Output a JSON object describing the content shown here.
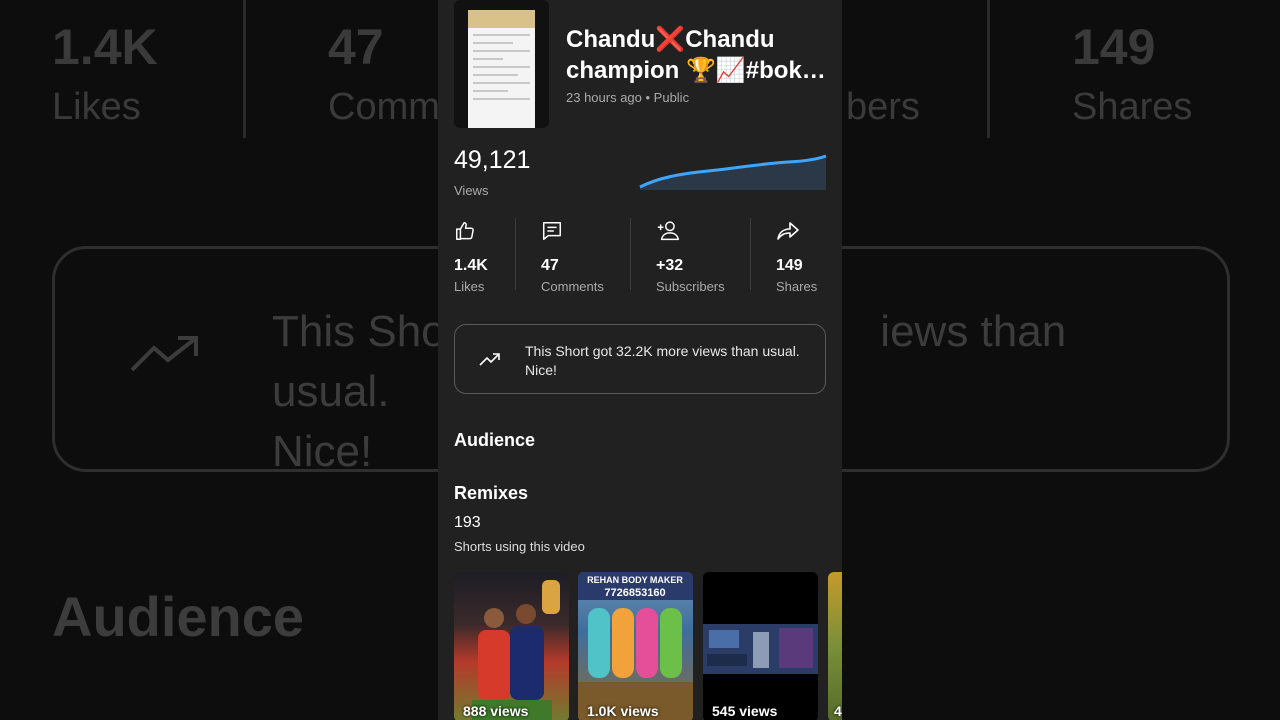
{
  "background": {
    "stats": [
      {
        "value": "1.4K",
        "label": "Likes"
      },
      {
        "value": "47",
        "label": "Comm"
      },
      {
        "value": "",
        "label": "bers"
      },
      {
        "value": "149",
        "label": "Shares"
      }
    ],
    "insight_left": "This Shor",
    "insight_right": "iews than usual.",
    "insight_line2": "Nice!",
    "audience": "Audience"
  },
  "video": {
    "title": "Chandu❌Chandu champion 🏆📈#bok…",
    "meta": "23 hours ago • Public",
    "views_value": "49,121",
    "views_label": "Views"
  },
  "stats": [
    {
      "icon": "thumbs-up-icon",
      "value": "1.4K",
      "label": "Likes"
    },
    {
      "icon": "comment-icon",
      "value": "47",
      "label": "Comments"
    },
    {
      "icon": "add-subscriber-icon",
      "value": "+32",
      "label": "Subscribers"
    },
    {
      "icon": "share-icon",
      "value": "149",
      "label": "Shares"
    }
  ],
  "insight": {
    "icon": "trending-up-icon",
    "text": "This Short got 32.2K more views than usual. Nice!"
  },
  "audience": {
    "heading": "Audience"
  },
  "remixes": {
    "heading": "Remixes",
    "count": "193",
    "label": "Shorts using this video",
    "tiles": [
      {
        "views": "888 views"
      },
      {
        "views": "1.0K views",
        "overlay_text": "REHAN BODY MAKER 7726853160"
      },
      {
        "views": "545 views"
      },
      {
        "views": "4"
      }
    ]
  },
  "colors": {
    "accent": "#3ea6ff",
    "panel": "#212121",
    "secondary_text": "#aaaaaa"
  }
}
